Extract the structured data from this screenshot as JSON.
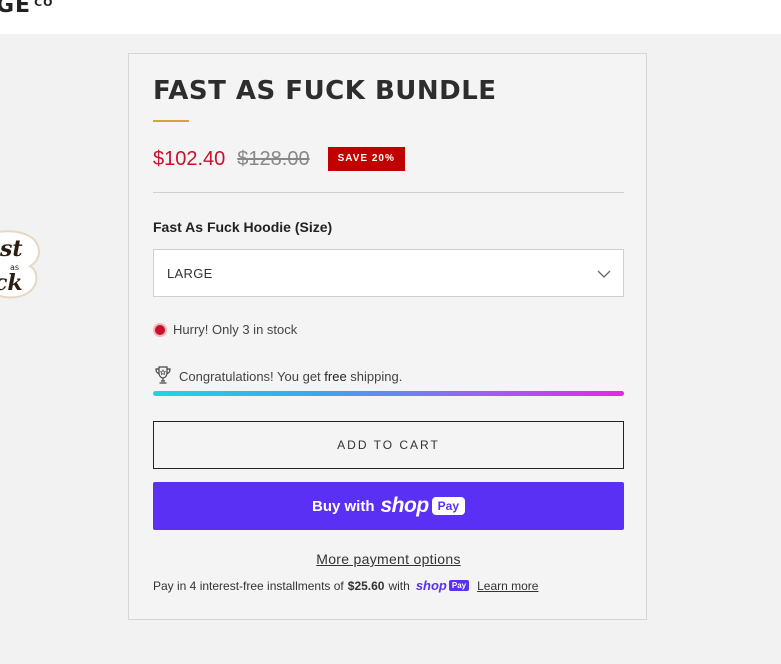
{
  "header": {
    "logo_text": "GE",
    "logo_suffix": "CO"
  },
  "product": {
    "title": "FAST AS FUCK BUNDLE",
    "price": "$102.40",
    "compare_price": "$128.00",
    "save_badge": "SAVE 20%",
    "option_label": "Fast As Fuck Hoodie (Size)",
    "option_selected": "LARGE",
    "stock_message": "Hurry! Only 3 in stock",
    "shipping": {
      "prefix": "Congratulations! You get ",
      "highlight": "free",
      "suffix": " shipping.",
      "progress_percent": 100
    },
    "add_to_cart_label": "ADD TO CART",
    "shop_pay": {
      "buy_with": "Buy with",
      "brand": "shop",
      "pay": "Pay"
    },
    "more_payment_label": "More payment options",
    "installments": {
      "prefix": "Pay in 4 interest-free installments of",
      "amount": "$25.60",
      "with": "with",
      "brand": "shop",
      "pay": "Pay",
      "learn_more": "Learn more"
    }
  },
  "colors": {
    "price": "#c8102e",
    "badge": "#c10000",
    "accent_rule": "#d4a53a",
    "shop_pay": "#5a31f4"
  },
  "icons": [
    "chevron-down-icon",
    "stock-dot-icon",
    "trophy-icon",
    "sticker-image"
  ]
}
